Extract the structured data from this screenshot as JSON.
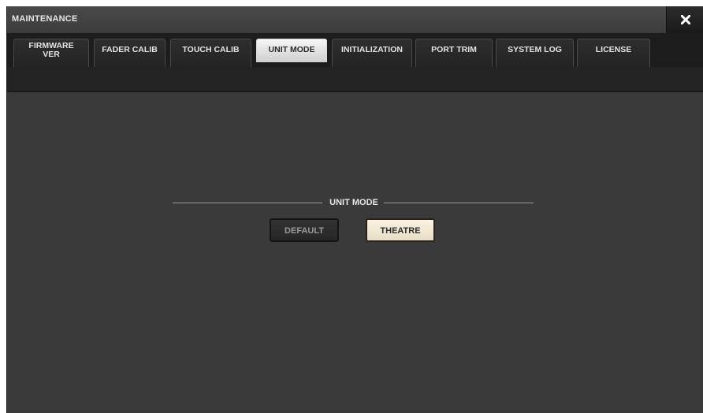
{
  "window": {
    "title": "MAINTENANCE",
    "close_icon": "close-icon"
  },
  "tabs": [
    {
      "label": "FIRMWARE VER",
      "line1": "FIRMWARE",
      "line2": "VER",
      "active": false
    },
    {
      "label": "FADER CALIB",
      "active": false
    },
    {
      "label": "TOUCH CALIB",
      "active": false
    },
    {
      "label": "UNIT MODE",
      "active": true
    },
    {
      "label": "INITIALIZATION",
      "active": false
    },
    {
      "label": "PORT TRIM",
      "active": false
    },
    {
      "label": "SYSTEM LOG",
      "active": false
    },
    {
      "label": "LICENSE",
      "active": false
    }
  ],
  "unit_mode": {
    "section_label": "UNIT MODE",
    "default_label": "DEFAULT",
    "theatre_label": "THEATRE",
    "selected": "THEATRE"
  },
  "colors": {
    "window_bg": "#3a3a3a",
    "tabbar_bg": "#1d1d1d",
    "active_tab": "#e6e6e6",
    "selected_button": "#f3ead8"
  }
}
